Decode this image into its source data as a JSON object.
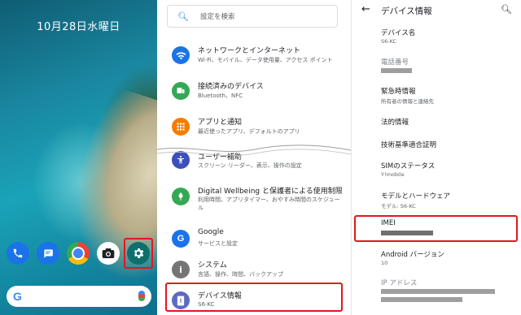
{
  "home": {
    "date": "10月28日水曜日",
    "dock": [
      {
        "icon": "phone-icon"
      },
      {
        "icon": "messages-icon"
      },
      {
        "icon": "chrome-icon"
      },
      {
        "icon": "camera-icon"
      },
      {
        "icon": "gear-icon"
      }
    ],
    "search_logo": "G"
  },
  "settings": {
    "search_placeholder": "設定を検索",
    "items": [
      {
        "title": "ネットワークとインターネット",
        "subtitle": "Wi-Fi、モバイル、データ使用量、アクセス ポイント",
        "icon": "wifi-icon",
        "color": "#1a73e8"
      },
      {
        "title": "接続済みのデバイス",
        "subtitle": "Bluetooth、NFC",
        "icon": "devices-icon",
        "color": "#34a853"
      },
      {
        "title": "アプリと通知",
        "subtitle": "最近使ったアプリ、デフォルトのアプリ",
        "icon": "apps-icon",
        "color": "#f57c00"
      },
      {
        "title": "ユーザー補助",
        "subtitle": "スクリーン リーダー、表示、操作の設定",
        "icon": "accessibility-icon",
        "color": "#3c4fbd"
      },
      {
        "title": "Digital Wellbeing と保護者による使用制限",
        "subtitle": "利用時間、アプリタイマー、おやすみ時間のスケジュール",
        "icon": "wellbeing-icon",
        "color": "#34a853"
      },
      {
        "title": "Google",
        "subtitle": "サービスと設定",
        "icon": "google-icon",
        "color": "#1a73e8"
      },
      {
        "title": "システム",
        "subtitle": "言語、操作、時間、バックアップ",
        "icon": "info-icon",
        "color": "#757575"
      },
      {
        "title": "デバイス情報",
        "subtitle": "S6-KC",
        "icon": "phone-info-icon",
        "color": "#5c6bc0"
      }
    ]
  },
  "device": {
    "title": "デバイス情報",
    "items": [
      {
        "label": "デバイス名",
        "value": "S6-KC"
      },
      {
        "label": "電話番号",
        "value": ""
      },
      {
        "label": "緊急時情報",
        "value": "所有者の情報と連絡先"
      },
      {
        "label": "法的情報",
        "value": ""
      },
      {
        "label": "技術基準適合証明",
        "value": ""
      },
      {
        "label": "SIMのステータス",
        "value": "Y!mobile"
      },
      {
        "label": "モデルとハードウェア",
        "value": "モデル: S6-KC"
      },
      {
        "label": "IMEI",
        "value": ""
      },
      {
        "label": "Android バージョン",
        "value": "10"
      },
      {
        "label": "IP アドレス",
        "value": ""
      }
    ]
  },
  "accent": "#e3161f"
}
